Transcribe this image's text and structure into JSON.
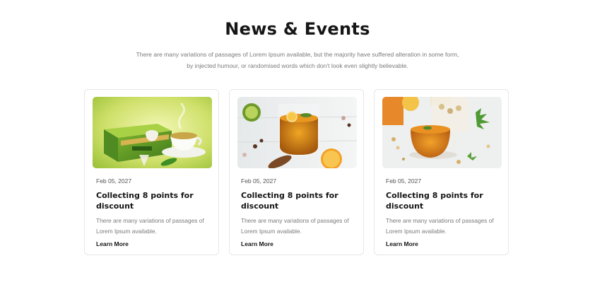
{
  "section": {
    "title": "News & Events",
    "subtitle_line1": "There are many variations of passages of Lorem Ipsum available, but the majority have suffered alteration in some form,",
    "subtitle_line2": "by injected humour, or randomised words which don't look even slightly believable."
  },
  "cards": [
    {
      "image_icon": "green-tea-box-image",
      "date": "Feb 05, 2027",
      "title": "Collecting 8 points for discount",
      "excerpt": "There are many variations of passages of Lorem Ipsum available.",
      "link": "Learn More"
    },
    {
      "image_icon": "citrus-tea-glass-image",
      "date": "Feb 05, 2027",
      "title": "Collecting 8 points for discount",
      "excerpt": "There are many variations of passages of Lorem Ipsum available.",
      "link": "Learn More"
    },
    {
      "image_icon": "herbal-tea-cup-image",
      "date": "Feb 05, 2027",
      "title": "Collecting 8 points for discount",
      "excerpt": "There are many variations of passages of Lorem Ipsum available.",
      "link": "Learn More"
    }
  ]
}
